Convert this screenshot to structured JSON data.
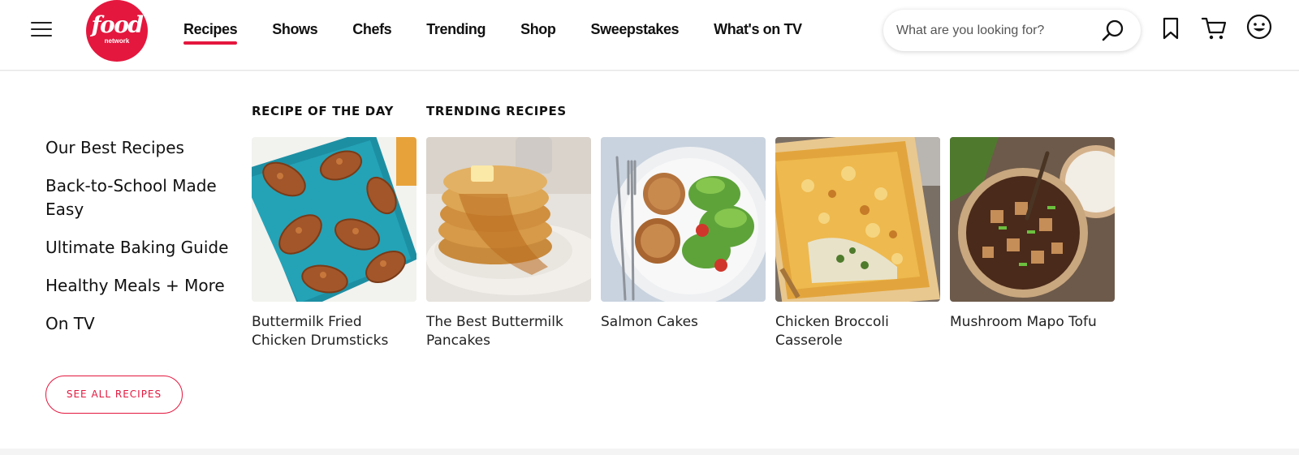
{
  "header": {
    "logo": {
      "word": "food",
      "sub": "network"
    },
    "nav": [
      "Recipes",
      "Shows",
      "Chefs",
      "Trending",
      "Shop",
      "Sweepstakes",
      "What's on TV"
    ],
    "active_nav": "Recipes",
    "search": {
      "placeholder": "What are you looking for?"
    },
    "icons": [
      "menu-icon",
      "search-icon",
      "bookmark-icon",
      "cart-icon",
      "account-smiley-icon"
    ]
  },
  "menu": {
    "links": [
      "Our Best Recipes",
      "Back-to-School Made Easy",
      "Ultimate Baking Guide",
      "Healthy Meals + More",
      "On TV"
    ],
    "see_all": "SEE ALL RECIPES",
    "recipe_of_day_heading": "RECIPE OF THE DAY",
    "trending_heading": "TRENDING RECIPES",
    "cards": [
      {
        "title": "Buttermilk Fried Chicken Drumsticks"
      },
      {
        "title": "The Best Buttermilk Pancakes"
      },
      {
        "title": "Salmon Cakes"
      },
      {
        "title": "Chicken Broccoli Casserole"
      },
      {
        "title": "Mushroom Mapo Tofu"
      }
    ]
  },
  "colors": {
    "brand": "#e4173e",
    "text": "#111111"
  }
}
